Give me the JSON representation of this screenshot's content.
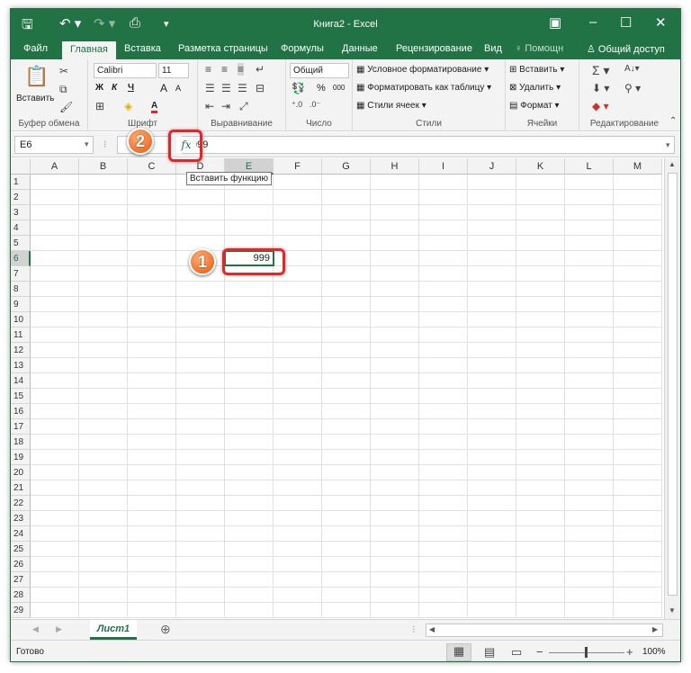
{
  "titlebar": {
    "title": "Книга2 - Excel",
    "save_icon": "save-icon",
    "undo_icon": "undo-icon",
    "redo_icon": "redo-icon",
    "preview_icon": "print-preview-icon"
  },
  "tabs": [
    "Файл",
    "Главная",
    "Вставка",
    "Разметка страницы",
    "Формулы",
    "Данные",
    "Рецензирование",
    "Вид"
  ],
  "tell_me": "Помощн",
  "share": "Общий доступ",
  "ribbon": {
    "clipboard": {
      "paste": "Вставить",
      "label": "Буфер обмена"
    },
    "font": {
      "name": "Calibri",
      "size": "11",
      "bold": "Ж",
      "italic": "К",
      "underline": "Ч",
      "grow": "A",
      "shrink": "A",
      "color_letter": "А",
      "label": "Шрифт"
    },
    "alignment": {
      "label": "Выравнивание"
    },
    "number": {
      "format": "Общий",
      "percent": "%",
      "thousands": "000",
      "label": "Число"
    },
    "styles": {
      "conditional": "Условное форматирование",
      "as_table": "Форматировать как таблицу",
      "cell_styles": "Стили ячеек",
      "label": "Стили"
    },
    "cells": {
      "insert": "Вставить",
      "delete": "Удалить",
      "format": "Формат",
      "label": "Ячейки"
    },
    "editing": {
      "label": "Редактирование"
    }
  },
  "formula_bar": {
    "name_box": "E6",
    "fx": "fx",
    "value": "999",
    "tooltip": "Вставить функцию"
  },
  "columns": [
    "A",
    "B",
    "C",
    "D",
    "E",
    "F",
    "G",
    "H",
    "I",
    "J",
    "K",
    "L",
    "M"
  ],
  "rows": [
    "1",
    "2",
    "3",
    "4",
    "5",
    "6",
    "7",
    "8",
    "9",
    "10",
    "11",
    "12",
    "13",
    "14",
    "15",
    "16",
    "17",
    "18",
    "19",
    "20",
    "21",
    "22",
    "23",
    "24",
    "25",
    "26",
    "27",
    "28",
    "29"
  ],
  "cell_e6": "999",
  "sheet": {
    "name": "Лист1",
    "add": "⊕"
  },
  "status": {
    "ready": "Готово",
    "zoom": "100%",
    "minus": "−",
    "plus": "+"
  },
  "callouts": {
    "one": "1",
    "two": "2"
  },
  "colors": {
    "excel_green": "#217346",
    "callout_red": "#e3262a",
    "callout_orange": "#ef6f2a"
  }
}
